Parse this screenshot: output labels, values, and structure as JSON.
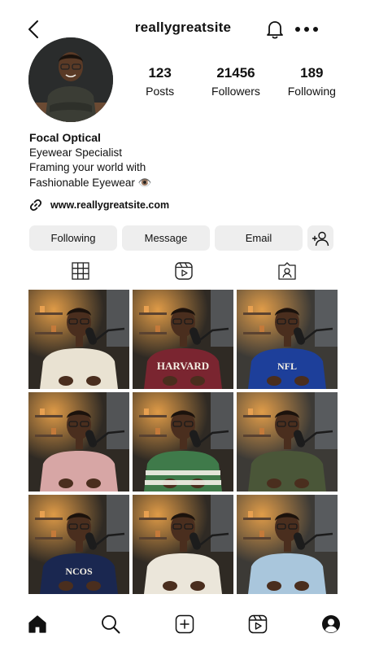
{
  "header": {
    "username": "reallygreatsite"
  },
  "stats": [
    {
      "value": "123",
      "label": "Posts"
    },
    {
      "value": "21456",
      "label": "Followers"
    },
    {
      "value": "189",
      "label": "Following"
    }
  ],
  "bio": {
    "name": "Focal Optical",
    "category": "Eyewear Specialist",
    "line1": "Framing your world with",
    "line2": "Fashionable Eyewear",
    "line2_emoji": "👁️"
  },
  "link": {
    "text": "www.reallygreatsite.com"
  },
  "actions": {
    "following_label": "Following",
    "message_label": "Message",
    "email_label": "Email"
  },
  "colors": {
    "text": "#111111",
    "button_bg": "#eeeeee",
    "background": "#ffffff"
  },
  "grid_posts": [
    {
      "sweater": "cream knit",
      "color": "#e9e2d2"
    },
    {
      "sweater": "maroon Harvard sweatshirt",
      "color": "#7a2530",
      "print": "HARVARD"
    },
    {
      "sweater": "blue NFL sweater",
      "color": "#1d3f9a",
      "print": "NFL"
    },
    {
      "sweater": "pink hoodie",
      "color": "#d7a6a5"
    },
    {
      "sweater": "green striped sweater",
      "color": "#3f7a4a"
    },
    {
      "sweater": "olive knit sweater",
      "color": "#4a5638"
    },
    {
      "sweater": "navy Broncos sweatshirt",
      "color": "#1a2750",
      "print": "NCOS"
    },
    {
      "sweater": "cream sweater",
      "color": "#ebe6da"
    },
    {
      "sweater": "light blue hoodie",
      "color": "#a9c6dc"
    }
  ],
  "icons": {
    "back": "chevron-left-icon",
    "bell": "bell-icon",
    "more": "more-icon",
    "link": "link-icon",
    "add_user": "add-user-icon",
    "grid": "grid-icon",
    "reels": "reels-icon",
    "tagged": "tagged-icon",
    "home": "home-icon",
    "search": "search-icon",
    "create": "create-icon",
    "profile": "profile-icon"
  }
}
